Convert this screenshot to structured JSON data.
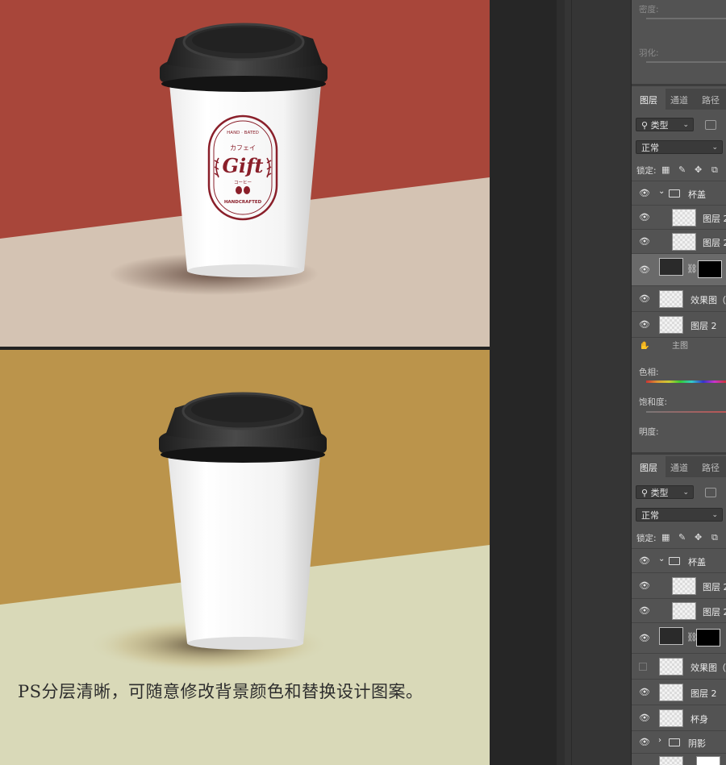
{
  "caption": "PS分层清晰，可随意修改背景颜色和替换设计图案。",
  "logo": {
    "top_text": "HAND · BATED",
    "katakana": "カフェイ",
    "brand": "Gift",
    "small": "コーヒー",
    "bottom_text": "HANDCRAFTED"
  },
  "colors": {
    "panel_a_wall": "#a8463a",
    "panel_a_table": "#d4c3b3",
    "panel_b_wall": "#bb944b",
    "panel_b_table": "#d9d9b8",
    "lid": "#2e2e2e",
    "logo": "#8a1f2a"
  },
  "properties": {
    "density_label": "密度:",
    "feather_label": "羽化:",
    "hue_label": "色相:",
    "saturation_label": "饱和度:",
    "lightness_label": "明度:",
    "partial_row": "主图"
  },
  "layers_top": {
    "tabs": [
      "图层",
      "通道",
      "路径"
    ],
    "filter": "类型",
    "blend_mode": "正常",
    "lock_label": "锁定:",
    "rows": [
      {
        "name": "杯盖",
        "kind": "group"
      },
      {
        "name": "图层 2",
        "kind": "layer"
      },
      {
        "name": "图层 2",
        "kind": "layer"
      },
      {
        "name": "",
        "kind": "masked"
      },
      {
        "name": "效果图（",
        "kind": "layer"
      },
      {
        "name": "图层 2",
        "kind": "layer"
      }
    ]
  },
  "layers_bottom": {
    "tabs": [
      "图层",
      "通道",
      "路径"
    ],
    "filter": "类型",
    "blend_mode": "正常",
    "lock_label": "锁定:",
    "rows": [
      {
        "name": "杯盖",
        "kind": "group"
      },
      {
        "name": "图层 2",
        "kind": "layer"
      },
      {
        "name": "图层 2",
        "kind": "layer"
      },
      {
        "name": "",
        "kind": "masked"
      },
      {
        "name": "效果图（",
        "kind": "layer"
      },
      {
        "name": "图层 2",
        "kind": "layer"
      },
      {
        "name": "杯身",
        "kind": "layer"
      },
      {
        "name": "阴影",
        "kind": "group"
      }
    ]
  }
}
